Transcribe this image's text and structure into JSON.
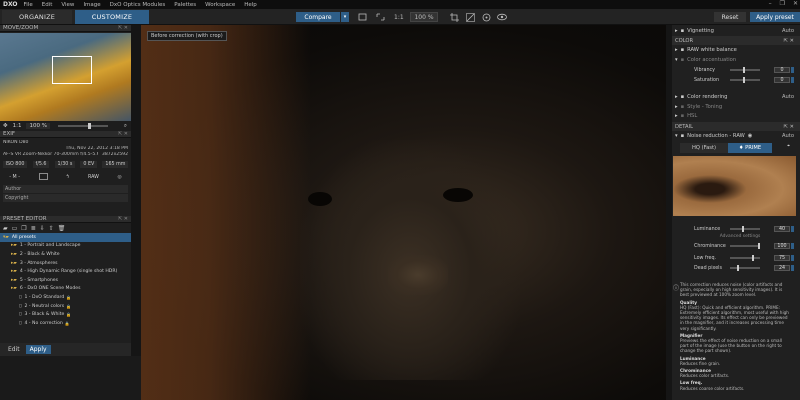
{
  "menubar": {
    "logo": "DXO",
    "items": [
      "File",
      "Edit",
      "View",
      "Image",
      "DxO Optics Modules",
      "Palettes",
      "Workspace",
      "Help"
    ],
    "window_controls": [
      "–",
      "❐",
      "✕"
    ]
  },
  "toolbar": {
    "organize": "ORGANIZE",
    "customize": "CUSTOMIZE",
    "compare": "Compare",
    "compare_dd": "▾",
    "zoom_fit": "1:1",
    "zoom": "100 %",
    "reset": "Reset",
    "apply_preset": "Apply preset"
  },
  "left": {
    "move_zoom": {
      "title": "MOVE/ZOOM",
      "controls": "⇱ ✕",
      "ratio": "1:1",
      "zoom": "100 %"
    },
    "exif": {
      "title": "EXIF",
      "controls": "⇱ ✕",
      "camera": "NIKON D80",
      "date": "Thu, Nov 22, 2012 3:18 PM",
      "lens": "AF-S VR Zoom-Nikkor 70-300mm f/4.5-5.6G IF-ED",
      "size": "3872x2592",
      "iso": "ISO 800",
      "aperture": "f/5.6",
      "shutter": "1/30 s",
      "ev": "0 EV",
      "focal": "165 mm",
      "mode": "- M -",
      "format": "RAW",
      "author_label": "Author",
      "copyright_label": "Copyright"
    },
    "preset_editor": {
      "title": "PRESET EDITOR",
      "controls": "⇱ ✕",
      "items": [
        {
          "label": "All presets",
          "level": 0,
          "selected": true
        },
        {
          "label": "1 - Portrait and Landscape",
          "level": 1
        },
        {
          "label": "2 - Black & White",
          "level": 1
        },
        {
          "label": "3 - Atmospheres",
          "level": 1
        },
        {
          "label": "4 - High Dynamic Range (single shot HDR)",
          "level": 1
        },
        {
          "label": "5 - Smartphones",
          "level": 1
        },
        {
          "label": "6 - DxO ONE Scene Modes",
          "level": 1
        },
        {
          "label": "1 - DxO Standard",
          "level": 2
        },
        {
          "label": "2 - Neutral colors",
          "level": 2
        },
        {
          "label": "3 - Black & White",
          "level": 2
        },
        {
          "label": "4 - No correction",
          "level": 2
        }
      ]
    },
    "edit": "Edit",
    "apply": "Apply"
  },
  "viewer": {
    "tooltip": "Before correction (with crop)"
  },
  "right": {
    "vignetting": "Vignetting",
    "vignetting_auto": "Auto",
    "color_section": "COLOR",
    "raw_wb": "RAW white balance",
    "color_accent": "Color accentuation",
    "vibrancy_label": "Vibrancy",
    "vibrancy": "0",
    "saturation_label": "Saturation",
    "saturation": "0",
    "color_rendering": "Color rendering",
    "color_rendering_auto": "Auto",
    "style_toning": "Style - Toning",
    "hsl": "HSL",
    "detail_section": "DETAIL",
    "noise_reduction": "Noise reduction - RAW",
    "noise_auto": "Auto",
    "tab_hq": "HQ (Fast)",
    "tab_prime": "♦ PRIME",
    "luminance_label": "Luminance",
    "luminance": "40",
    "advanced": "Advanced settings",
    "chrominance_label": "Chrominance",
    "chrominance": "100",
    "lowfreq_label": "Low freq.",
    "lowfreq": "75",
    "deadpix_label": "Dead pixels",
    "deadpix": "24",
    "help": {
      "intro": "This correction reduces noise (color artifacts and grain, especially on high sensitivity images). It is best previewed at 100% zoom level.",
      "quality_h": "Quality",
      "quality": "HQ (Fast): Quick and efficient algorithm. PRIME: Extremely efficient algorithm, most useful with high sensitivity images. Its effect can only be previewed in the magnifier, and it increases processing time very significantly.",
      "mag_h": "Magnifier",
      "mag": "Previews the effect of noise reduction on a small part of the image (use the button on the right to change the part shown).",
      "lum_h": "Luminance",
      "lum": "Reduces fine grain.",
      "chr_h": "Chrominance",
      "chr": "Reduces color artifacts.",
      "lf_h": "Low freq.",
      "lf": "Reduces coarse color artifacts."
    }
  }
}
